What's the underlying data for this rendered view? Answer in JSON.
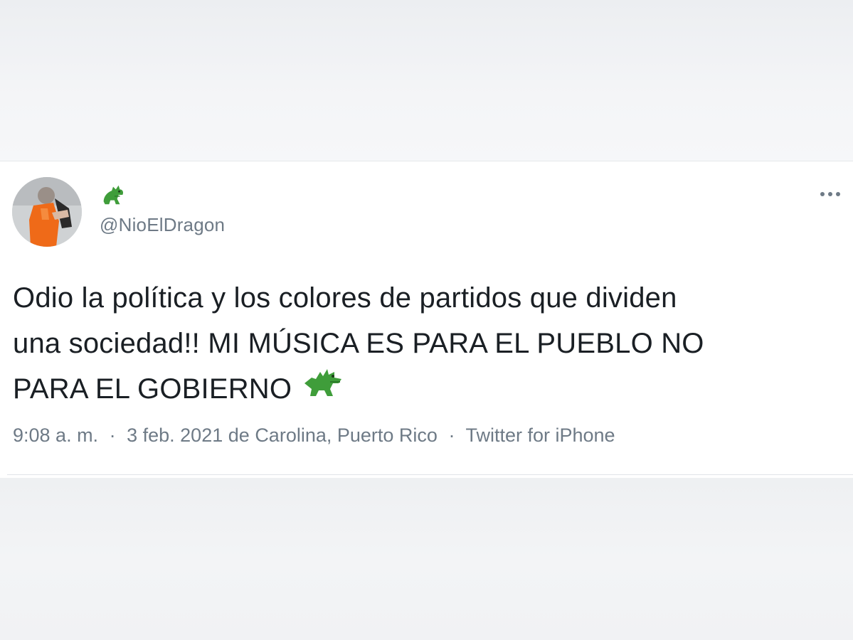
{
  "tweet": {
    "display_name_icon": "dragon-icon",
    "handle": "@NioElDragon",
    "text_lines": [
      "Odio la política y los colores de partidos que dividen",
      "una sociedad!! MI MÚSICA ES PARA EL PUEBLO NO",
      "PARA EL GOBIERNO"
    ],
    "trailing_icon": "dragon-icon",
    "time": "9:08 a. m.",
    "date": "3 feb. 2021",
    "location_prefix": "de",
    "location": "Carolina, Puerto Rico",
    "source": "Twitter for iPhone",
    "separator": "·",
    "more_icon": "more-dots-icon"
  },
  "colors": {
    "dragon_green": "#3f9d3a",
    "text_primary": "#1a1f24",
    "text_secondary": "#6e7a86",
    "avatar_vest": "#ef6a18"
  }
}
